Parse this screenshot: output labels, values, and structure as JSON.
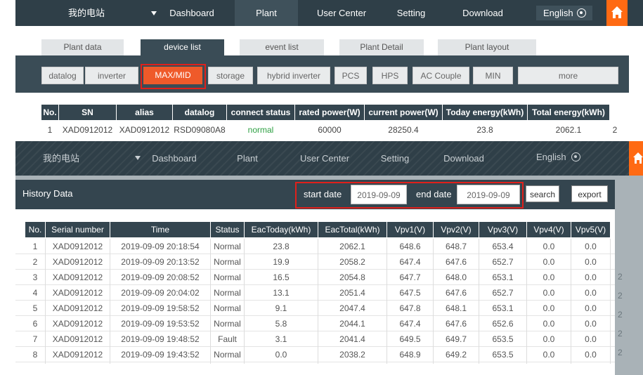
{
  "top_nav": {
    "plant_selector": "我的电站",
    "dashboard": "Dashboard",
    "plant": "Plant",
    "user_center": "User Center",
    "setting": "Setting",
    "download": "Download",
    "language": "English"
  },
  "tabs": [
    "Plant data",
    "device list",
    "event list",
    "Plant Detail",
    "Plant layout"
  ],
  "device_types": [
    "datalog",
    "inverter",
    "MAX/MID",
    "storage",
    "hybrid inverter",
    "PCS",
    "HPS",
    "AC Couple",
    "MIN",
    "more"
  ],
  "device_table": {
    "headers": [
      "No.",
      "SN",
      "alias",
      "datalog",
      "connect status",
      "rated power(W)",
      "current power(W)",
      "Today energy(kWh)",
      "Total energy(kWh)"
    ],
    "row": [
      "1",
      "XAD0912012",
      "XAD0912012",
      "RSD09080A8",
      "normal",
      "60000",
      "28250.4",
      "23.8",
      "2062.1"
    ],
    "overflow_value": "2"
  },
  "history": {
    "title": "History Data",
    "start_label": "start date",
    "start_value": "2019-09-09",
    "end_label": "end date",
    "end_value": "2019-09-09",
    "search": "search",
    "export": "export",
    "headers": [
      "No.",
      "Serial number",
      "Time",
      "Status",
      "EacToday(kWh)",
      "EacTotal(kWh)",
      "Vpv1(V)",
      "Vpv2(V)",
      "Vpv3(V)",
      "Vpv4(V)",
      "Vpv5(V)"
    ],
    "rows": [
      [
        "1",
        "XAD0912012",
        "2019-09-09 20:18:54",
        "Normal",
        "23.8",
        "2062.1",
        "648.6",
        "648.7",
        "653.4",
        "0.0",
        "0.0"
      ],
      [
        "2",
        "XAD0912012",
        "2019-09-09 20:13:52",
        "Normal",
        "19.9",
        "2058.2",
        "647.4",
        "647.6",
        "652.7",
        "0.0",
        "0.0"
      ],
      [
        "3",
        "XAD0912012",
        "2019-09-09 20:08:52",
        "Normal",
        "16.5",
        "2054.8",
        "647.7",
        "648.0",
        "653.1",
        "0.0",
        "0.0"
      ],
      [
        "4",
        "XAD0912012",
        "2019-09-09 20:04:02",
        "Normal",
        "13.1",
        "2051.4",
        "647.5",
        "647.6",
        "652.7",
        "0.0",
        "0.0"
      ],
      [
        "5",
        "XAD0912012",
        "2019-09-09 19:58:52",
        "Normal",
        "9.1",
        "2047.4",
        "647.8",
        "648.1",
        "653.1",
        "0.0",
        "0.0"
      ],
      [
        "6",
        "XAD0912012",
        "2019-09-09 19:53:52",
        "Normal",
        "5.8",
        "2044.1",
        "647.4",
        "647.6",
        "652.6",
        "0.0",
        "0.0"
      ],
      [
        "7",
        "XAD0912012",
        "2019-09-09 19:48:52",
        "Fault",
        "3.1",
        "2041.4",
        "649.5",
        "649.7",
        "653.5",
        "0.0",
        "0.0"
      ],
      [
        "8",
        "XAD0912012",
        "2019-09-09 19:43:52",
        "Normal",
        "0.0",
        "2038.2",
        "648.9",
        "649.2",
        "653.5",
        "0.0",
        "0.0"
      ]
    ],
    "side_values": [
      "2",
      "2",
      "2",
      "2",
      "2"
    ]
  },
  "colors": {
    "accent": "#ef5a2a",
    "home": "#ff6a13",
    "nav": "#2f3f48",
    "highlight": "#e0201b",
    "normal": "#2ea043"
  }
}
